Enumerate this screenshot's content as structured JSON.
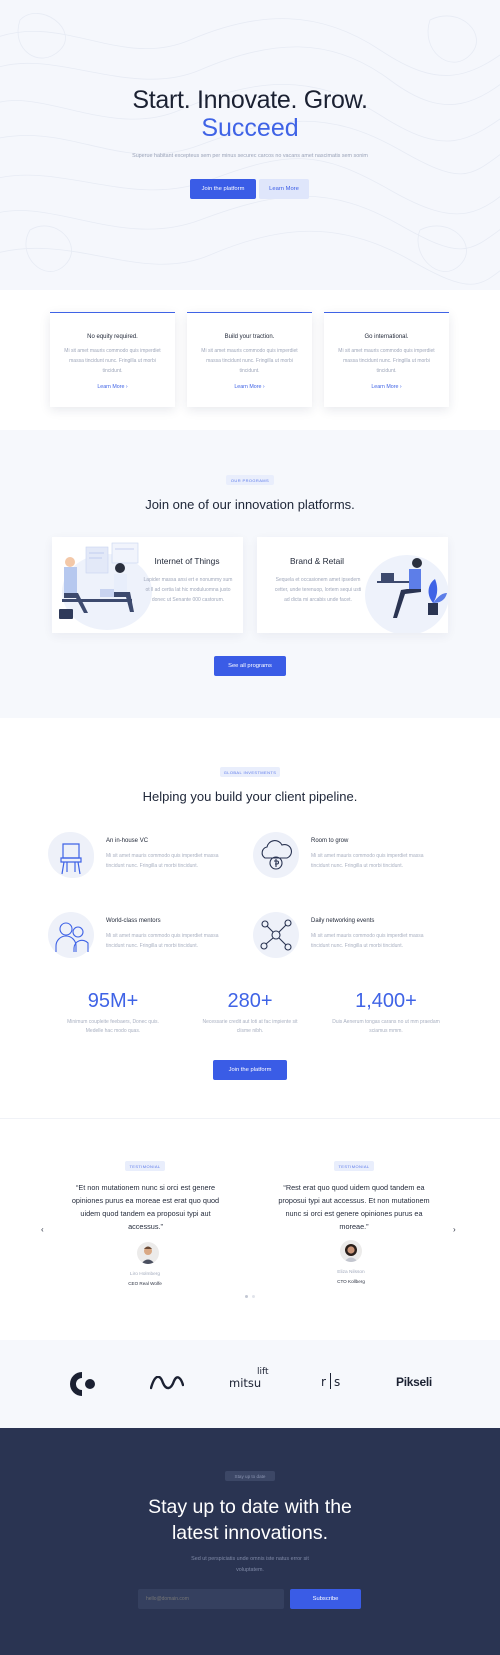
{
  "hero": {
    "title": "Start. Innovate. Grow.",
    "accent": "Succeed",
    "subtitle": "Superue habitant excepteus sem per minus securec carcos no vacans amet nascimatis sem sonim",
    "btn_primary": "Join the platform",
    "btn_secondary": "Learn More"
  },
  "features": [
    {
      "title": "No equity required.",
      "desc": "Mi sit amet mauris commodo quis imperdiet massa tincidunt nunc. Fringilla ut morbi tincidunt.",
      "link": "Learn More ›"
    },
    {
      "title": "Build your traction.",
      "desc": "Mi sit amet mauris commodo quis imperdiet massa tincidunt nunc. Fringilla ut morbi tincidunt.",
      "link": "Learn More ›"
    },
    {
      "title": "Go international.",
      "desc": "Mi sit amet mauris commodo quis imperdiet massa tincidunt nunc. Fringilla ut morbi tincidunt.",
      "link": "Learn More ›"
    }
  ],
  "programs": {
    "eyebrow": "OUR PROGRAMS",
    "title": "Join one of our innovation platforms.",
    "cards": [
      {
        "title": "Internet of Things",
        "desc": "Lapider massa ansi ert e nonummy sum ot ll ad certia lat hic moduluomna justo donec ut Senante 000 castorum."
      },
      {
        "title": "Brand & Retail",
        "desc": "Sequela et occasionem amet ipsedem cetter, unde terenuop, lortem sequi usti ad dicta mi arcabis unde facet."
      }
    ],
    "button": "See all programs"
  },
  "pipeline": {
    "eyebrow": "GLOBAL INVESTMENTS",
    "title": "Helping you build your client pipeline.",
    "items": [
      {
        "title": "An in-house VC",
        "desc": "Mi sit amet mauris commodo quis imperdiet massa tincidunt nunc. Fringilla ut morbi tincidunt.",
        "icon": "chair-icon"
      },
      {
        "title": "Room to grow",
        "desc": "Mi sit amet mauris commodo quis imperdiet massa tincidunt nunc. Fringilla ut morbi tincidunt.",
        "icon": "cloud-money-icon"
      },
      {
        "title": "World-class mentors",
        "desc": "Mi sit amet mauris commodo quis imperdiet massa tincidunt nunc. Fringilla ut morbi tincidunt.",
        "icon": "people-icon"
      },
      {
        "title": "Daily networking events",
        "desc": "Mi sit amet mauris commodo quis imperdiet massa tincidunt nunc. Fringilla ut morbi tincidunt.",
        "icon": "network-icon"
      }
    ],
    "stats": [
      {
        "value": "95M+",
        "desc": "Minimum coupleite feebaers, Donec quis. Medelle hac modo quas."
      },
      {
        "value": "280+",
        "desc": "Necessarie credit aut loti at fac impiente sit clisme nibh."
      },
      {
        "value": "1,400+",
        "desc": "Duis Aenerum tongas carans no ut mm praedam sciamus mmm."
      }
    ],
    "button": "Join the platform"
  },
  "testimonials": {
    "items": [
      {
        "badge": "TESTIMONIAL",
        "quote": "“Et non mutationem nunc si orci est genere opiniones purus ea moreae est erat quo quod uidem quod tandem ea proposui typi aut accessus.”",
        "name": "Liro Holmberg",
        "role": "CEO Real Wolfe"
      },
      {
        "badge": "TESTIMONIAL",
        "quote": "“Rest erat quo quod uidem quod tandem ea proposui typi aut accessus. Et non mutationem nunc si orci est genere opiniones purus ea moreae.”",
        "name": "Eliza Nilsson",
        "role": "CTO Kollberg"
      }
    ],
    "prev": "‹",
    "next": "›"
  },
  "logos": [
    "mitsu",
    "lift",
    "r",
    "s",
    "Pikseli"
  ],
  "newsletter": {
    "eyebrow": "Stay up to date",
    "title_line1": "Stay up to date with the",
    "title_line2": "latest innovations.",
    "subtitle_line1": "Sed ut perspiciatis unde omnis iste natus error sit",
    "subtitle_line2": "voluptatem.",
    "placeholder": "hello@domain.com",
    "button": "Subscribe"
  },
  "colors": {
    "accent": "#3f63e6",
    "dark": "#2a3452"
  }
}
